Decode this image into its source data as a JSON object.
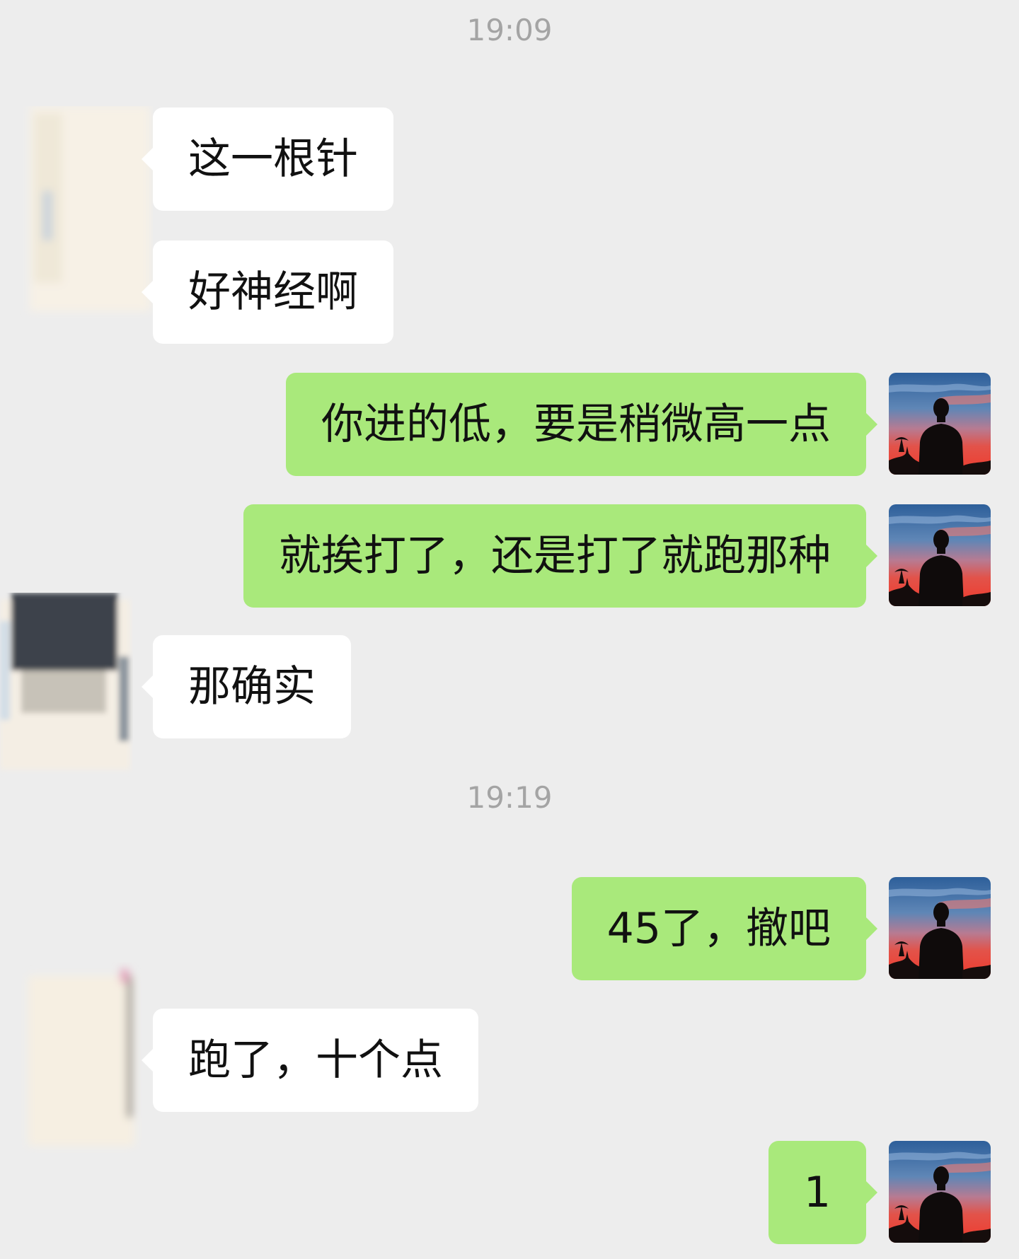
{
  "colors": {
    "background": "#ededed",
    "incoming_bubble": "#ffffff",
    "outgoing_bubble": "#a9e97b",
    "timestamp_text": "#a4a4a4",
    "message_text": "#111111"
  },
  "chat": {
    "timestamps": [
      "19:09",
      "19:19"
    ],
    "messages": [
      {
        "direction": "incoming",
        "text": "这一根针",
        "avatar": "blurred-avatar-icon"
      },
      {
        "direction": "incoming",
        "text": "好神经啊",
        "avatar": "blurred-avatar-icon"
      },
      {
        "direction": "outgoing",
        "text": "你进的低，要是稍微高一点",
        "avatar": "silhouette-sunset-avatar-icon"
      },
      {
        "direction": "outgoing",
        "text": "就挨打了，还是打了就跑那种",
        "avatar": "silhouette-sunset-avatar-icon"
      },
      {
        "direction": "incoming",
        "text": "那确实",
        "avatar": "blurred-avatar-icon"
      },
      {
        "direction": "outgoing",
        "text": "45了，撤吧",
        "avatar": "silhouette-sunset-avatar-icon"
      },
      {
        "direction": "incoming",
        "text": "跑了，十个点",
        "avatar": "blurred-avatar-icon"
      },
      {
        "direction": "outgoing",
        "text": "1",
        "avatar": "silhouette-sunset-avatar-icon"
      }
    ]
  }
}
